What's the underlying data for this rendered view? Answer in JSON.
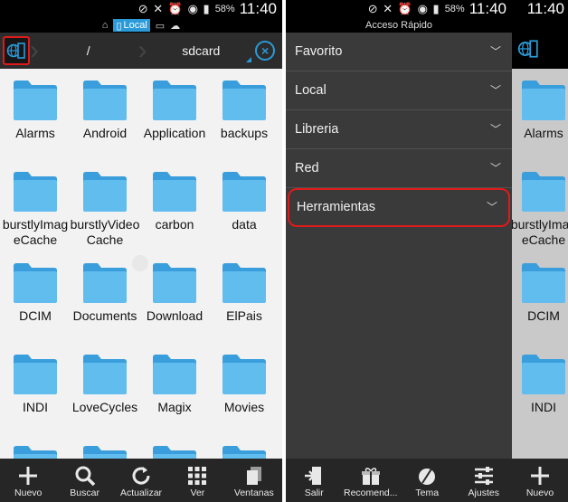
{
  "status_bar": {
    "battery": "58%",
    "time": "11:40"
  },
  "left_panel": {
    "location_chip": "Local",
    "path": {
      "root": "/",
      "current": "sdcard"
    },
    "folders": [
      "Alarms",
      "Android",
      "Application",
      "backups",
      "burstlyImageCache",
      "burstlyVideoCache",
      "carbon",
      "data",
      "DCIM",
      "Documents",
      "Download",
      "ElPais",
      "INDI",
      "LoveCycles",
      "Magix",
      "Movies",
      "",
      "",
      "",
      ""
    ],
    "bottom_bar": [
      {
        "label": "Nuevo",
        "icon": "plus-icon"
      },
      {
        "label": "Buscar",
        "icon": "search-icon"
      },
      {
        "label": "Actualizar",
        "icon": "refresh-icon"
      },
      {
        "label": "Ver",
        "icon": "grid-view-icon"
      },
      {
        "label": "Ventanas",
        "icon": "windows-icon"
      }
    ]
  },
  "middle_panel": {
    "title": "Acceso Rápido",
    "items": [
      {
        "label": "Favorito"
      },
      {
        "label": "Local"
      },
      {
        "label": "Libreria"
      },
      {
        "label": "Red"
      },
      {
        "label": "Herramientas",
        "highlighted": true
      }
    ],
    "bottom_bar": [
      {
        "label": "Salir",
        "icon": "exit-icon"
      },
      {
        "label": "Recomend...",
        "icon": "gift-icon"
      },
      {
        "label": "Tema",
        "icon": "theme-icon"
      },
      {
        "label": "Ajustes",
        "icon": "settings-sliders-icon"
      }
    ]
  },
  "right_panel": {
    "folders": [
      "Alarms",
      "burstlyImageCache",
      "DCIM",
      "INDI"
    ],
    "bottom_bar": [
      {
        "label": "Nuevo",
        "icon": "plus-icon"
      }
    ]
  },
  "colors": {
    "accent": "#2a9ad8",
    "highlight_red": "#e01a1a",
    "folder": "#5fb6ea"
  }
}
